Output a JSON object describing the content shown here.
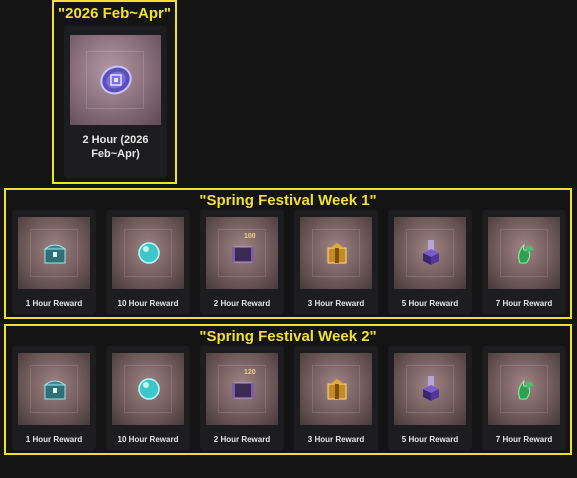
{
  "groups": [
    {
      "title": "\"2026 Feb~Apr\"",
      "items": [
        {
          "label": "2 Hour (2026 Feb~Apr)",
          "icon": "purple-token-icon"
        }
      ]
    },
    {
      "title": "\"Spring Festival Week 1\"",
      "items": [
        {
          "label": "1 Hour Reward",
          "icon": "treasure-chest-icon"
        },
        {
          "label": "10 Hour Reward",
          "icon": "cyan-orb-icon"
        },
        {
          "label": "2 Hour Reward",
          "icon": "scroll-ticket-icon",
          "qty": "100"
        },
        {
          "label": "3 Hour Reward",
          "icon": "gold-box-icon"
        },
        {
          "label": "5 Hour Reward",
          "icon": "glowing-cube-icon"
        },
        {
          "label": "7 Hour Reward",
          "icon": "green-crystal-icon"
        }
      ]
    },
    {
      "title": "\"Spring Festival Week 2\"",
      "items": [
        {
          "label": "1 Hour Reward",
          "icon": "treasure-chest-icon"
        },
        {
          "label": "10 Hour Reward",
          "icon": "cyan-orb-icon"
        },
        {
          "label": "2 Hour Reward",
          "icon": "scroll-ticket-icon",
          "qty": "120"
        },
        {
          "label": "3 Hour Reward",
          "icon": "gold-box-icon"
        },
        {
          "label": "5 Hour Reward",
          "icon": "glowing-cube-icon"
        },
        {
          "label": "7 Hour Reward",
          "icon": "green-crystal-icon"
        }
      ]
    }
  ],
  "colors": {
    "highlight_border": "#f2e12a",
    "title_text": "#f2e12a",
    "card_bg": "#1d1d1f",
    "label_text": "#e6e6e6"
  }
}
